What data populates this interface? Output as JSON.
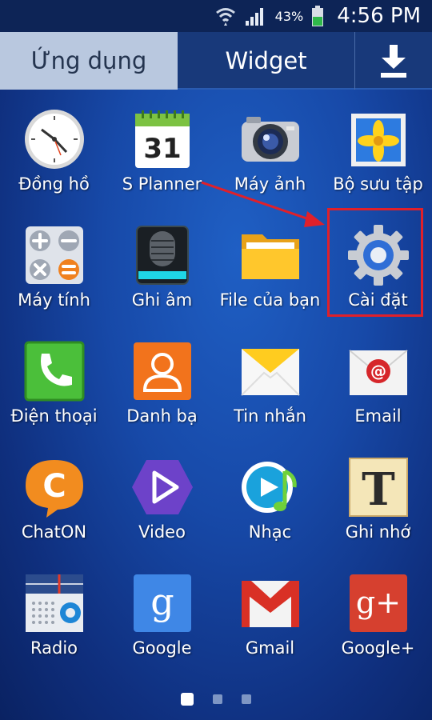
{
  "status_bar": {
    "battery_percent": "43%",
    "time": "4:56 PM",
    "icons": [
      "wifi-icon",
      "signal-icon",
      "battery-icon"
    ]
  },
  "tabs": {
    "apps_label": "Ứng dụng",
    "widget_label": "Widget",
    "download_icon": "download-icon"
  },
  "apps": [
    {
      "label": "Đồng hồ",
      "icon": "clock-icon"
    },
    {
      "label": "S Planner",
      "icon": "calendar-icon",
      "calendar_day": "31"
    },
    {
      "label": "Máy ảnh",
      "icon": "camera-icon"
    },
    {
      "label": "Bộ sưu tập",
      "icon": "gallery-icon"
    },
    {
      "label": "Máy tính",
      "icon": "calculator-icon"
    },
    {
      "label": "Ghi âm",
      "icon": "microphone-icon"
    },
    {
      "label": "File của bạn",
      "icon": "folder-icon"
    },
    {
      "label": "Cài đặt",
      "icon": "settings-gear-icon",
      "highlighted": true
    },
    {
      "label": "Điện thoại",
      "icon": "phone-icon"
    },
    {
      "label": "Danh bạ",
      "icon": "contacts-icon"
    },
    {
      "label": "Tin nhắn",
      "icon": "messages-envelope-icon"
    },
    {
      "label": "Email",
      "icon": "email-icon"
    },
    {
      "label": "ChatON",
      "icon": "chaton-icon",
      "glyph": "C"
    },
    {
      "label": "Video",
      "icon": "video-play-icon"
    },
    {
      "label": "Nhạc",
      "icon": "music-icon"
    },
    {
      "label": "Ghi nhớ",
      "icon": "memo-icon",
      "glyph": "T"
    },
    {
      "label": "Radio",
      "icon": "radio-icon"
    },
    {
      "label": "Google",
      "icon": "google-icon",
      "glyph": "g"
    },
    {
      "label": "Gmail",
      "icon": "gmail-icon"
    },
    {
      "label": "Google+",
      "icon": "google-plus-icon",
      "glyph": "g+"
    }
  ],
  "pages": {
    "count": 3,
    "current": 1
  },
  "colors": {
    "highlight": "#e0202a",
    "arrow": "#e0202a",
    "tab_active_bg": "#b9c8df"
  }
}
